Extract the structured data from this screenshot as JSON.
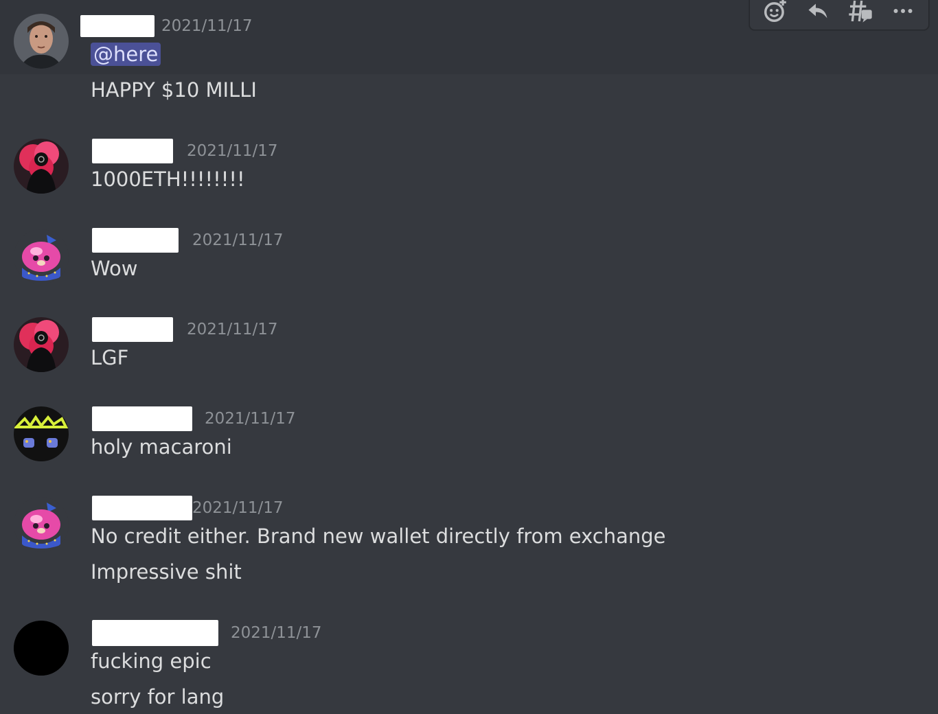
{
  "toolbar": {
    "buttons": [
      {
        "icon": "add-reaction-icon"
      },
      {
        "icon": "reply-icon"
      },
      {
        "icon": "create-thread-icon"
      },
      {
        "icon": "more-options-icon"
      }
    ]
  },
  "messages": [
    {
      "timestamp": "2021/11/17",
      "mention": "@here",
      "lines": [
        "HAPPY $10 MILLI"
      ],
      "avatar": "face-photo"
    },
    {
      "timestamp": "2021/11/17",
      "lines": [
        "1000ETH!!!!!!!!"
      ],
      "avatar": "pink-smoke-silhouette"
    },
    {
      "timestamp": "2021/11/17",
      "lines": [
        "Wow"
      ],
      "avatar": "pink-wizard-blob"
    },
    {
      "timestamp": "2021/11/17",
      "lines": [
        "LGF"
      ],
      "avatar": "pink-smoke-silhouette"
    },
    {
      "timestamp": "2021/11/17",
      "lines": [
        "holy macaroni"
      ],
      "avatar": "graffiti-logo"
    },
    {
      "timestamp": "2021/11/17",
      "lines": [
        "No credit either. Brand new wallet directly from exchange",
        "Impressive shit"
      ],
      "avatar": "pink-wizard-blob"
    },
    {
      "timestamp": "2021/11/17",
      "lines": [
        "fucking epic",
        "sorry for lang"
      ],
      "avatar": "black-circle"
    }
  ],
  "colors": {
    "background": "#36393f",
    "hover_background": "#32353b",
    "text": "#dcddde",
    "timestamp": "#8e9297",
    "mention_bg": "#4b5197",
    "mention_text": "#dee0fc"
  }
}
